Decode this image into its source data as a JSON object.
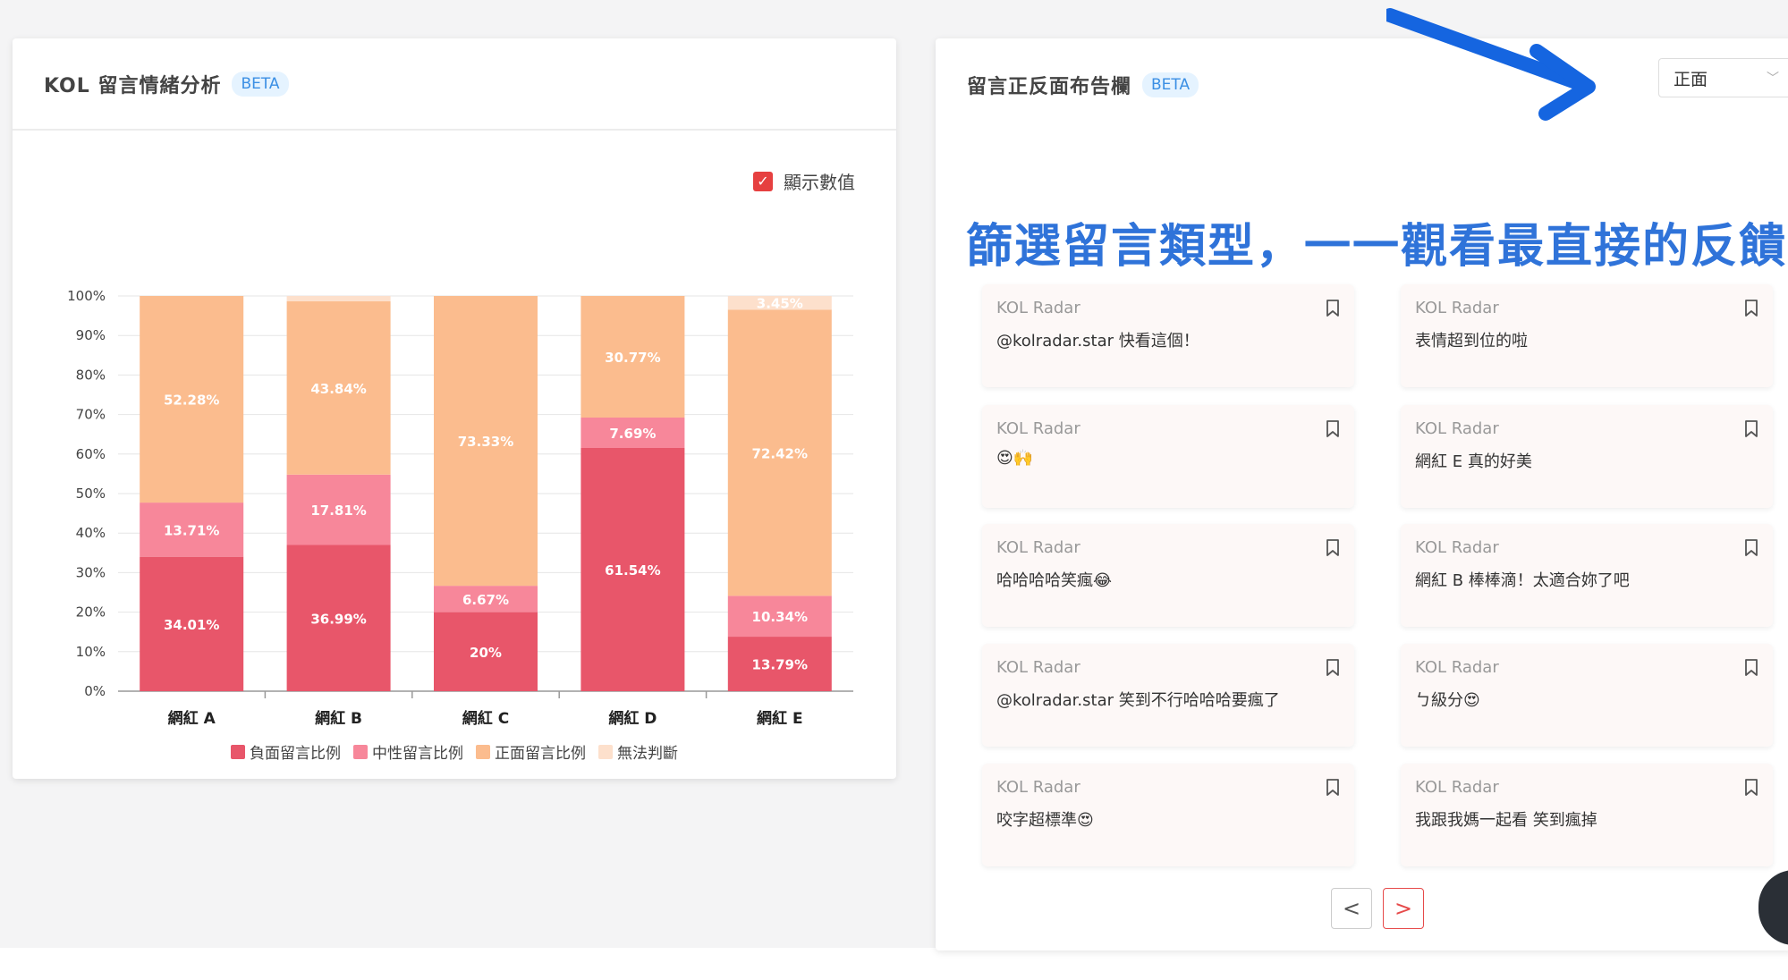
{
  "left_panel": {
    "title": "KOL 留言情緒分析",
    "beta": "BETA",
    "show_values_label": "顯示數值",
    "show_values_checked": true
  },
  "chart_data": {
    "type": "bar",
    "stacked": true,
    "categories": [
      "網紅 A",
      "網紅 B",
      "網紅 C",
      "網紅 D",
      "網紅 E"
    ],
    "y_ticks": [
      "0%",
      "10%",
      "20%",
      "30%",
      "40%",
      "50%",
      "60%",
      "70%",
      "80%",
      "90%",
      "100%"
    ],
    "ylim": [
      0,
      100
    ],
    "grid": true,
    "legend_position": "bottom",
    "series": [
      {
        "name": "負面留言比例",
        "color": "#e8566a",
        "values": [
          34.01,
          36.99,
          20,
          61.54,
          13.79
        ],
        "labels": [
          "34.01%",
          "36.99%",
          "20%",
          "61.54%",
          "13.79%"
        ]
      },
      {
        "name": "中性留言比例",
        "color": "#f7879a",
        "values": [
          13.71,
          17.81,
          6.67,
          7.69,
          10.34
        ],
        "labels": [
          "13.71%",
          "17.81%",
          "6.67%",
          "7.69%",
          "10.34%"
        ]
      },
      {
        "name": "正面留言比例",
        "color": "#fbbc8e",
        "values": [
          52.28,
          43.84,
          73.33,
          30.77,
          72.42
        ],
        "labels": [
          "52.28%",
          "43.84%",
          "73.33%",
          "30.77%",
          "72.42%"
        ]
      },
      {
        "name": "無法判斷",
        "color": "#fde0cc",
        "values": [
          0,
          1.36,
          0,
          0,
          3.45
        ],
        "labels": [
          "",
          "",
          "",
          "",
          "3.45%"
        ]
      }
    ]
  },
  "right_panel": {
    "title": "留言正反面布告欄",
    "beta": "BETA",
    "filter_value": "正面",
    "banner": "篩選留言類型，一一觀看最直接的反饋",
    "comments": [
      {
        "author": "KOL Radar",
        "text": "@kolradar.star 快看這個！"
      },
      {
        "author": "KOL Radar",
        "text": "表情超到位的啦"
      },
      {
        "author": "KOL Radar",
        "text": "😍🙌"
      },
      {
        "author": "KOL Radar",
        "text": "網紅 E 真的好美"
      },
      {
        "author": "KOL Radar",
        "text": "哈哈哈哈笑瘋😂"
      },
      {
        "author": "KOL Radar",
        "text": "網紅 B 棒棒滴！太適合妳了吧"
      },
      {
        "author": "KOL Radar",
        "text": "@kolradar.star 笑到不行哈哈哈要瘋了"
      },
      {
        "author": "KOL Radar",
        "text": "ㄅ級分😍"
      },
      {
        "author": "KOL Radar",
        "text": "咬字超標準😍"
      },
      {
        "author": "KOL Radar",
        "text": "我跟我媽一起看 笑到瘋掉"
      }
    ],
    "prev_label": "<",
    "next_label": ">"
  },
  "colors": {
    "accent": "#2f73d9",
    "danger": "#e64a4a",
    "beta_bg": "#e5f3ff"
  },
  "icons": {
    "bookmark": "bookmark-icon",
    "check": "check-icon",
    "chevron": "chevron-down-icon",
    "arrow": "annotation-arrow"
  }
}
